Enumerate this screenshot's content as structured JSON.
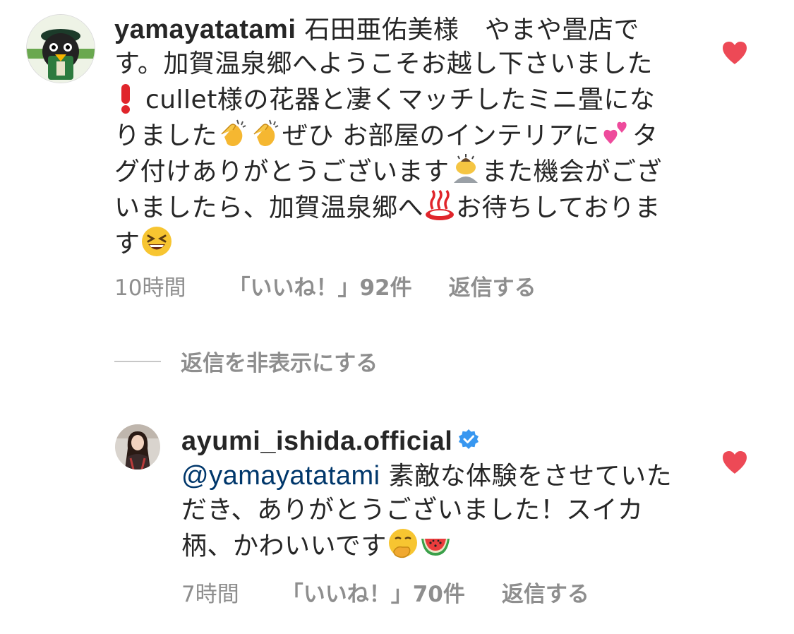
{
  "comment1": {
    "username": "yamayatatami",
    "text_parts": [
      " 石田亜佑美様　やまや畳店です。加賀温泉郷へようこそお越し下さいました",
      " cullet様の花器と凄くマッチしたミニ畳になりました",
      "ぜひ お部屋のインテリアに",
      "タグ付けありがとうございます",
      "また機会がございましたら、加賀温泉郷へ",
      "お待ちしております"
    ],
    "time": "10時間",
    "likes": "「いいね！」92件",
    "reply": "返信する",
    "liked": true
  },
  "hide_replies": "返信を非表示にする",
  "comment2": {
    "username": "ayumi_ishida.official",
    "verified": true,
    "mention": "@yamayatatami",
    "text_parts": [
      " 素敵な体験をさせていただき、ありがとうございました！スイカ柄、かわいいです"
    ],
    "time": "7時間",
    "likes": "「いいね！」70件",
    "reply": "返信する",
    "liked": true
  },
  "icons": {
    "heart": "heart-icon",
    "verified": "verified-badge-icon",
    "exclamation": "red-exclamation-emoji",
    "clap": "clapping-hands-emoji",
    "hearts": "two-hearts-emoji",
    "bow": "person-bowing-emoji",
    "hot_spring": "hot-springs-emoji",
    "laugh": "grinning-squinting-face-emoji",
    "shush": "face-with-hand-over-mouth-emoji",
    "watermelon": "watermelon-emoji"
  },
  "colors": {
    "heart": "#ed4956",
    "muted": "#8e8e8e",
    "mention": "#00376b",
    "verified": "#3897f0"
  }
}
